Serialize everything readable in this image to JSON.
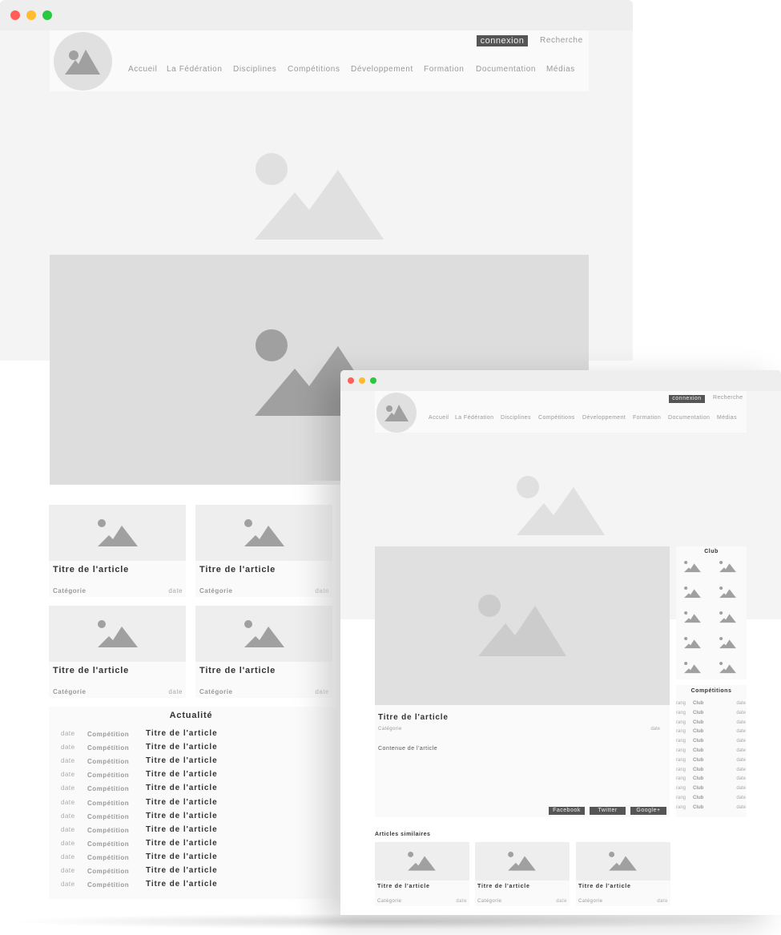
{
  "colors": {
    "close": "#ff5f57",
    "minimize": "#febc2e",
    "maximize": "#28c840",
    "dark_button": "#555555",
    "placeholder": "#e0e0e0"
  },
  "icons": {
    "logo": "image-placeholder-icon",
    "hero": "image-placeholder-icon"
  },
  "header": {
    "login": "connexion",
    "search": "Recherche",
    "nav": [
      "Accueil",
      "La Fédération",
      "Disciplines",
      "Compétitions",
      "Développement",
      "Formation",
      "Documentation",
      "Médias"
    ]
  },
  "home": {
    "cards": [
      {
        "title": "Titre de l'article",
        "category": "Catégorie",
        "date": "date"
      },
      {
        "title": "Titre de l'article",
        "category": "Catégorie",
        "date": "date"
      },
      {
        "title": "Titre de l'article",
        "category": "Catégorie",
        "date": "date"
      },
      {
        "title": "Titre de l'article",
        "category": "Catégorie",
        "date": "date"
      }
    ],
    "news": {
      "title": "Actualité",
      "rows": [
        {
          "date": "date",
          "category": "Compétition",
          "title": "Titre de l'article"
        },
        {
          "date": "date",
          "category": "Compétition",
          "title": "Titre de l'article"
        },
        {
          "date": "date",
          "category": "Compétition",
          "title": "Titre de l'article"
        },
        {
          "date": "date",
          "category": "Compétition",
          "title": "Titre de l'article"
        },
        {
          "date": "date",
          "category": "Compétition",
          "title": "Titre de l'article"
        },
        {
          "date": "date",
          "category": "Compétition",
          "title": "Titre de l'article"
        },
        {
          "date": "date",
          "category": "Compétition",
          "title": "Titre de l'article"
        },
        {
          "date": "date",
          "category": "Compétition",
          "title": "Titre de l'article"
        },
        {
          "date": "date",
          "category": "Compétition",
          "title": "Titre de l'article"
        },
        {
          "date": "date",
          "category": "Compétition",
          "title": "Titre de l'article"
        },
        {
          "date": "date",
          "category": "Compétition",
          "title": "Titre de l'article"
        },
        {
          "date": "date",
          "category": "Compétition",
          "title": "Titre de l'article"
        }
      ]
    }
  },
  "article": {
    "title": "Titre de l'article",
    "category": "Catégorie",
    "date": "date",
    "content": "Contenue de l'article",
    "share": [
      "Facebook",
      "Twitter",
      "Google+"
    ],
    "similar_title": "Articles similaires",
    "similar": [
      {
        "title": "Titre de l'article",
        "category": "Catégorie",
        "date": "date"
      },
      {
        "title": "Titre de l'article",
        "category": "Catégorie",
        "date": "date"
      },
      {
        "title": "Titre de l'article",
        "category": "Catégorie",
        "date": "date"
      }
    ]
  },
  "sidebar": {
    "club_title": "Club",
    "club_logo_count": 10,
    "competitions_title": "Compétitions",
    "rows": [
      {
        "rank": "rang",
        "club": "Club",
        "date": "date"
      },
      {
        "rank": "rang",
        "club": "Club",
        "date": "date"
      },
      {
        "rank": "rang",
        "club": "Club",
        "date": "date"
      },
      {
        "rank": "rang",
        "club": "Club",
        "date": "date"
      },
      {
        "rank": "rang",
        "club": "Club",
        "date": "date"
      },
      {
        "rank": "rang",
        "club": "Club",
        "date": "date"
      },
      {
        "rank": "rang",
        "club": "Club",
        "date": "date"
      },
      {
        "rank": "rang",
        "club": "Club",
        "date": "date"
      },
      {
        "rank": "rang",
        "club": "Club",
        "date": "date"
      },
      {
        "rank": "rang",
        "club": "Club",
        "date": "date"
      },
      {
        "rank": "rang",
        "club": "Club",
        "date": "date"
      },
      {
        "rank": "rang",
        "club": "Club",
        "date": "date"
      }
    ]
  }
}
